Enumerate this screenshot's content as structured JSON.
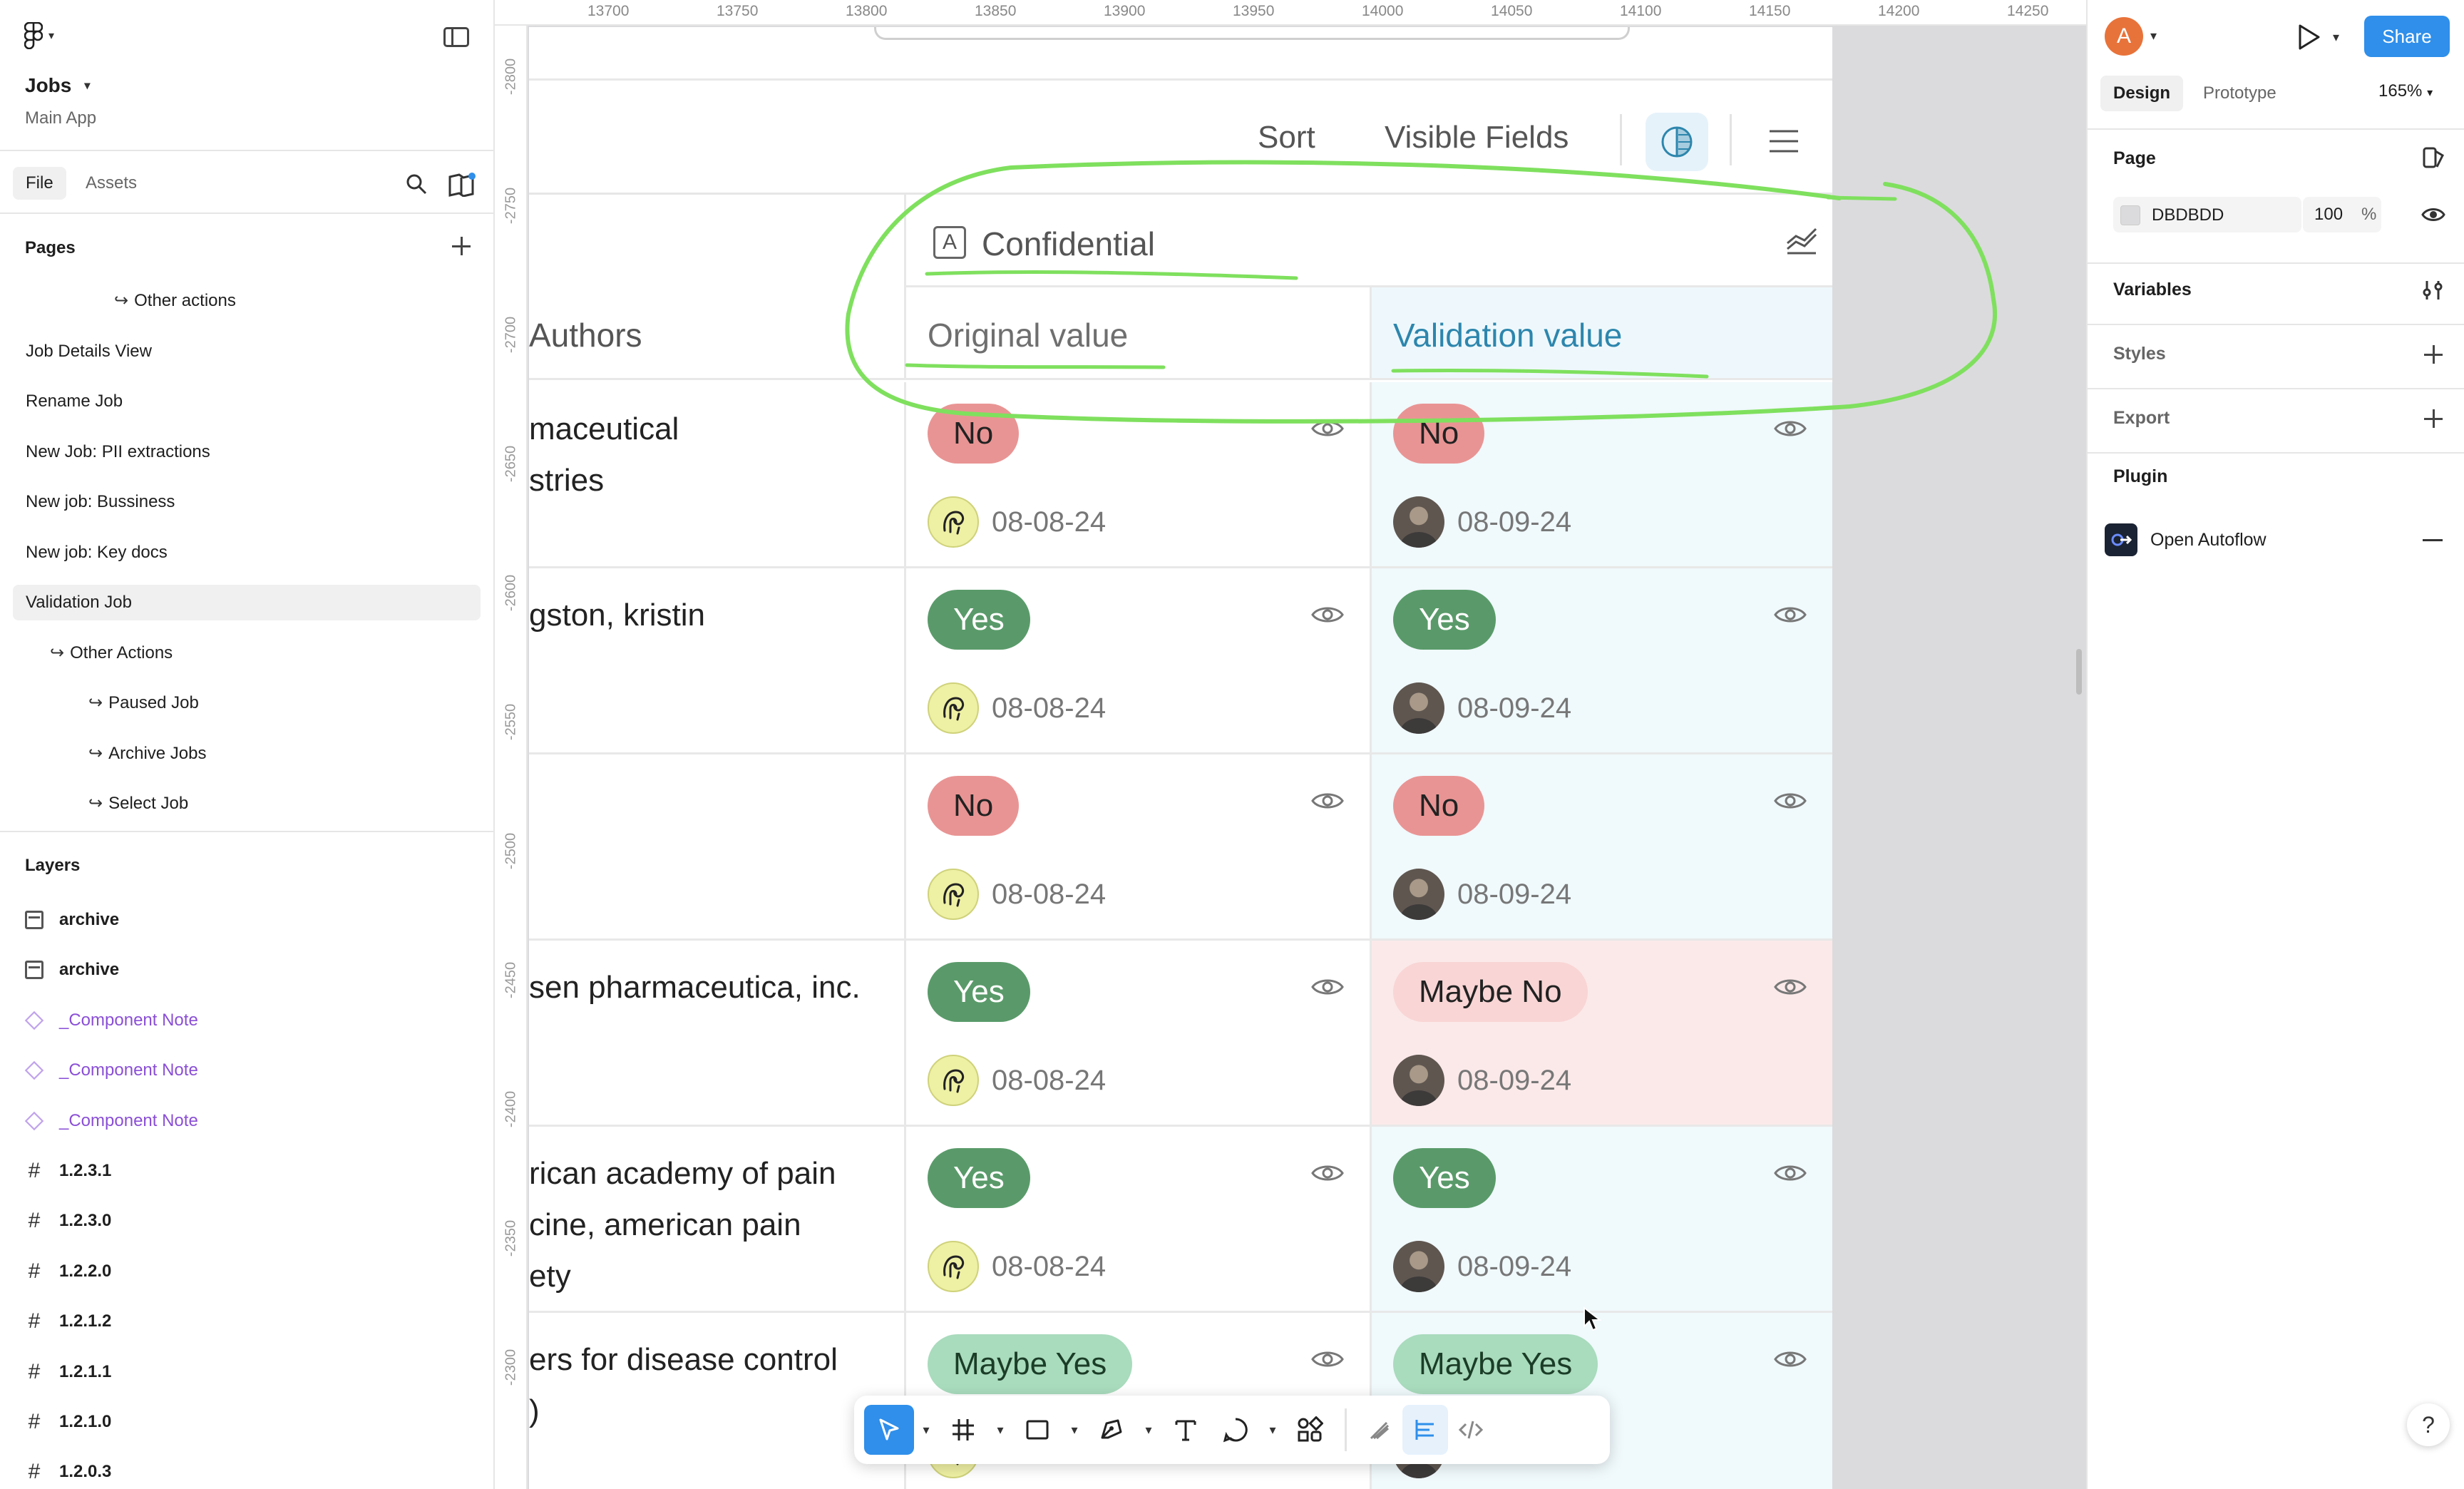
{
  "app": {
    "project_name": "Jobs",
    "project_subtitle": "Main App"
  },
  "left_panel": {
    "tabs": {
      "file": "File",
      "assets": "Assets"
    },
    "pages_title": "Pages",
    "pages": [
      {
        "label": "Other actions",
        "indent": 2,
        "arrow": true
      },
      {
        "label": "Job Details View",
        "indent": 0,
        "arrow": false
      },
      {
        "label": "Rename Job",
        "indent": 0,
        "arrow": false
      },
      {
        "label": "New Job: PII extractions",
        "indent": 0,
        "arrow": false
      },
      {
        "label": "New job: Bussiness",
        "indent": 0,
        "arrow": false
      },
      {
        "label": "New job: Key docs",
        "indent": 0,
        "arrow": false
      },
      {
        "label": "Validation Job",
        "indent": 0,
        "arrow": false,
        "selected": true
      },
      {
        "label": "Other Actions",
        "indent": 1,
        "arrow": true
      },
      {
        "label": "Paused Job",
        "indent": 2,
        "arrow": true
      },
      {
        "label": "Archive Jobs",
        "indent": 2,
        "arrow": true
      },
      {
        "label": "Select Job",
        "indent": 2,
        "arrow": true
      }
    ],
    "layers_title": "Layers",
    "layers": [
      {
        "label": "archive",
        "type": "frame"
      },
      {
        "label": "archive",
        "type": "frame"
      },
      {
        "label": "_Component Note",
        "type": "component"
      },
      {
        "label": "_Component Note",
        "type": "component"
      },
      {
        "label": "_Component Note",
        "type": "component"
      },
      {
        "label": "1.2.3.1",
        "type": "hash"
      },
      {
        "label": "1.2.3.0",
        "type": "hash"
      },
      {
        "label": "1.2.2.0",
        "type": "hash"
      },
      {
        "label": "1.2.1.2",
        "type": "hash"
      },
      {
        "label": "1.2.1.1",
        "type": "hash"
      },
      {
        "label": "1.2.1.0",
        "type": "hash"
      },
      {
        "label": "1.2.0.3",
        "type": "hash"
      }
    ]
  },
  "canvas": {
    "background_color": "#DBDBDD",
    "ruler_top": [
      "13700",
      "13750",
      "13800",
      "13850",
      "13900",
      "13950",
      "14000",
      "14050",
      "14100",
      "14150",
      "14200",
      "14250"
    ],
    "ruler_left": [
      "-2800",
      "-2750",
      "-2700",
      "-2650",
      "-2600",
      "-2550",
      "-2500",
      "-2450",
      "-2400",
      "-2350",
      "-2300"
    ]
  },
  "design": {
    "toolbar": {
      "sort": "Sort",
      "visible_fields": "Visible Fields"
    },
    "group_label": "Confidential",
    "group_icon_letter": "A",
    "columns": {
      "authors": "Authors",
      "original": "Original value",
      "validation": "Validation value"
    },
    "rows": [
      {
        "author": "maceutical\nstries",
        "original": {
          "value": "No",
          "kind": "no",
          "date": "08-08-24"
        },
        "validation": {
          "value": "No",
          "kind": "no",
          "date": "08-09-24"
        },
        "flag": false
      },
      {
        "author": "gston, kristin",
        "original": {
          "value": "Yes",
          "kind": "yes",
          "date": "08-08-24"
        },
        "validation": {
          "value": "Yes",
          "kind": "yes",
          "date": "08-09-24"
        },
        "flag": false
      },
      {
        "author": "",
        "original": {
          "value": "No",
          "kind": "no",
          "date": "08-08-24"
        },
        "validation": {
          "value": "No",
          "kind": "no",
          "date": "08-09-24"
        },
        "flag": false
      },
      {
        "author": "sen pharmaceutica, inc.",
        "original": {
          "value": "Yes",
          "kind": "yes",
          "date": "08-08-24"
        },
        "validation": {
          "value": "Maybe No",
          "kind": "maybeno",
          "date": "08-09-24"
        },
        "flag": true
      },
      {
        "author": "rican academy of pain\ncine, american pain\nety",
        "original": {
          "value": "Yes",
          "kind": "yes",
          "date": "08-08-24"
        },
        "validation": {
          "value": "Yes",
          "kind": "yes",
          "date": "08-09-24"
        },
        "flag": false
      },
      {
        "author": "ers for disease control\n)",
        "original": {
          "value": "Maybe Yes",
          "kind": "maybeyes",
          "date": ""
        },
        "validation": {
          "value": "Maybe Yes",
          "kind": "maybeyes",
          "date": ""
        },
        "flag": false
      }
    ]
  },
  "right_panel": {
    "user_initial": "A",
    "share_label": "Share",
    "tabs": {
      "design": "Design",
      "prototype": "Prototype"
    },
    "zoom": "165%",
    "page_title": "Page",
    "page_color_hex": "DBDBDD",
    "page_opacity": "100",
    "page_opacity_unit": "%",
    "variables_title": "Variables",
    "styles_title": "Styles",
    "export_title": "Export",
    "plugin_title": "Plugin",
    "plugin_name": "Open Autoflow",
    "help": "?"
  }
}
